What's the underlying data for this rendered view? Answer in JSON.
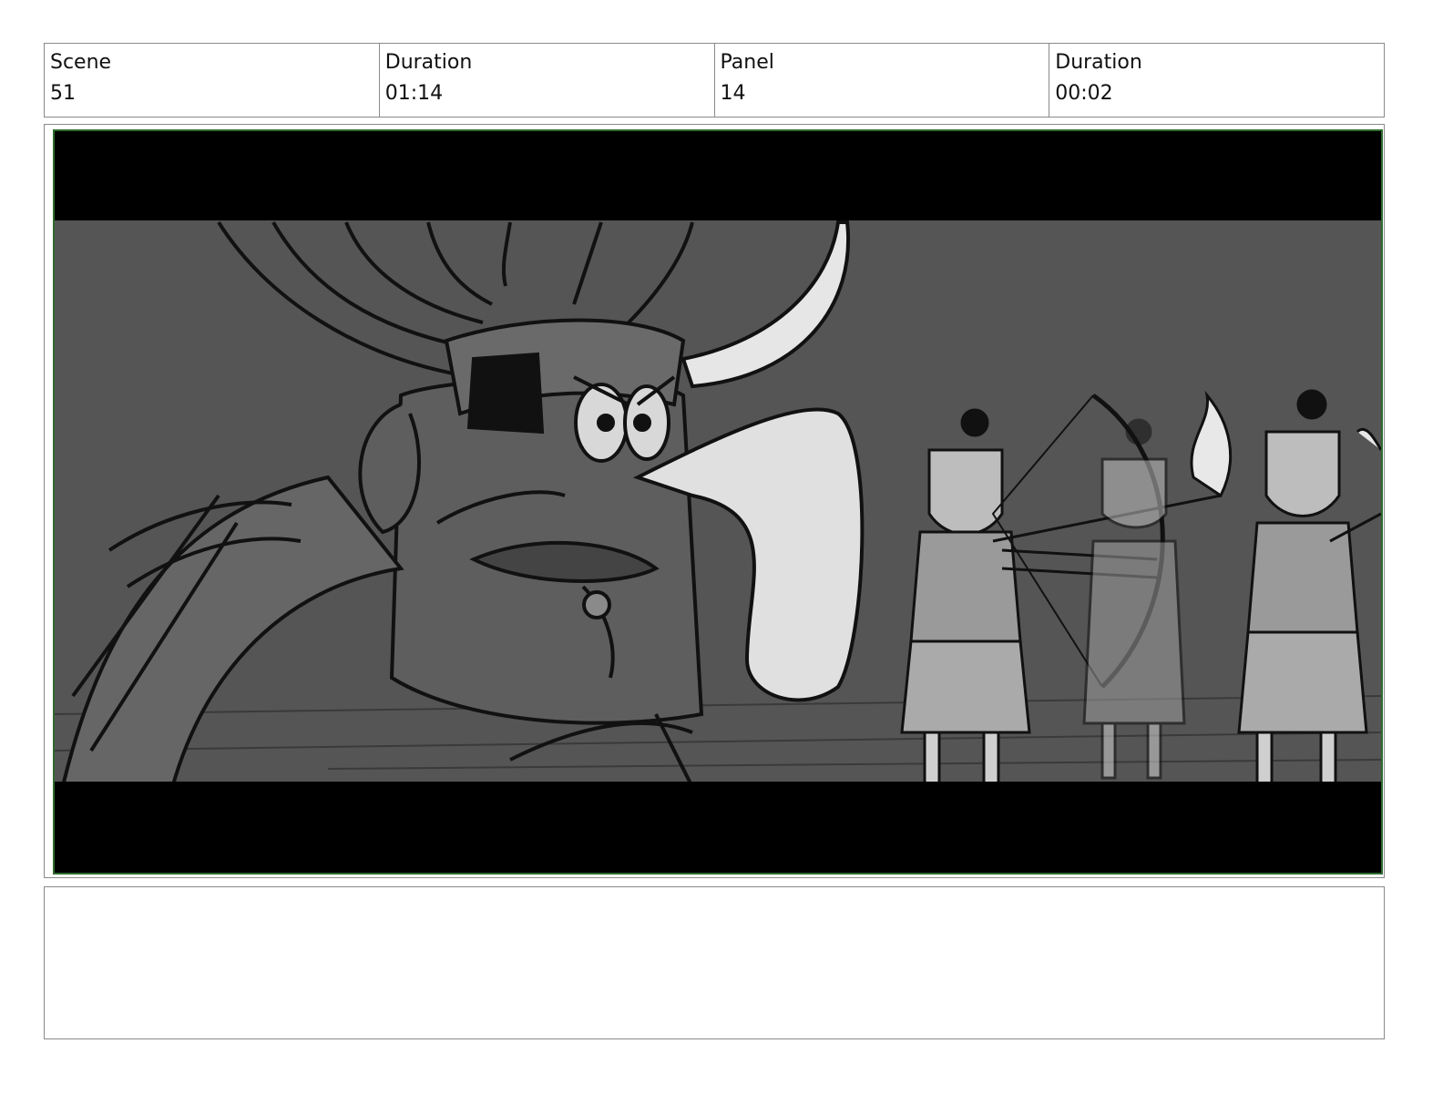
{
  "header": {
    "scene_label": "Scene",
    "scene_value": "51",
    "scene_duration_label": "Duration",
    "scene_duration_value": "01:14",
    "panel_label": "Panel",
    "panel_value": "14",
    "panel_duration_label": "Duration",
    "panel_duration_value": "00:02"
  },
  "panel": {
    "frame_border_color": "#2f6b2f",
    "letterbox_color": "#000000",
    "background_color": "#555555"
  },
  "notes": {
    "text": ""
  }
}
